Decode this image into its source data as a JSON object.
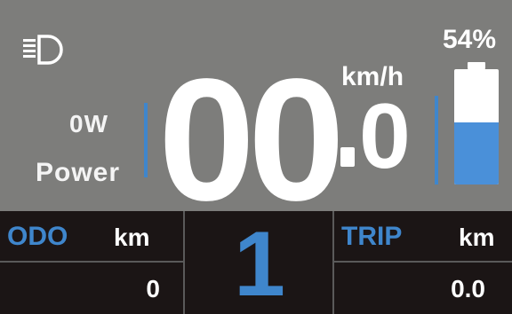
{
  "status": {
    "headlight_icon": "headlight-icon",
    "battery_percent_label": "54%",
    "battery_level": 0.54
  },
  "power": {
    "value": "0W",
    "label": "Power"
  },
  "speed": {
    "integer": "00",
    "decimal": "0",
    "unit": "km/h"
  },
  "odometer": {
    "label": "ODO",
    "unit": "km",
    "value": "0"
  },
  "gear": {
    "value": "1"
  },
  "trip": {
    "label": "TRIP",
    "unit": "km",
    "value": "0.0"
  },
  "colors": {
    "top_bg": "#7d7d7b",
    "bottom_bg": "#1b1515",
    "accent": "#3f86cc",
    "battery_fill": "#4a90d9",
    "text": "#ffffff"
  }
}
